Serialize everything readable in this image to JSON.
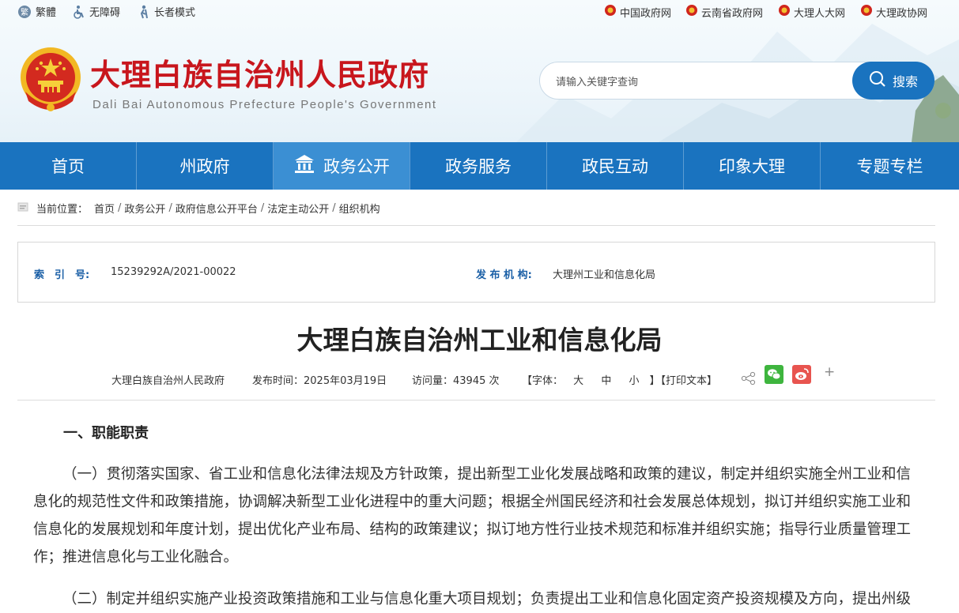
{
  "topbar": {
    "tools": [
      "繁體",
      "无障碍",
      "长者模式"
    ],
    "links": [
      "中国政府网",
      "云南省政府网",
      "大理人大网",
      "大理政协网"
    ]
  },
  "site": {
    "title": "大理白族自治州人民政府",
    "subtitle": "Dali Bai Autonomous Prefecture People's Government"
  },
  "search": {
    "placeholder": "请输入关键字查询",
    "button": "搜索"
  },
  "nav": [
    "首页",
    "州政府",
    "政务公开",
    "政务服务",
    "政民互动",
    "印象大理",
    "专题专栏"
  ],
  "breadcrumb": {
    "label": "当前位置：",
    "items": [
      "首页",
      "政务公开",
      "政府信息公开平台",
      "法定主动公开",
      "组织机构"
    ]
  },
  "info": {
    "index_label": "索　引　号:",
    "index_value": "15239292A/2021-00022",
    "org_label": "发 布 机 构:",
    "org_value": "大理州工业和信息化局"
  },
  "doc": {
    "title": "大理白族自治州工业和信息化局",
    "source": "大理白族自治州人民政府",
    "date": "发布时间：2025年03月19日",
    "visits": "访问量：43945 次",
    "font_label": "【字体：",
    "font_sizes": [
      "大",
      "中",
      "小"
    ],
    "font_close": "】",
    "print": "【打印文本】"
  },
  "content": {
    "section1": "一、职能职责",
    "p1": "（一）贯彻落实国家、省工业和信息化法律法规及方针政策，提出新型工业化发展战略和政策的建议，制定并组织实施全州工业和信息化的规范性文件和政策措施，协调解决新型工业化进程中的重大问题；根据全州国民经济和社会发展总体规划，拟订并组织实施工业和信息化的发展规划和年度计划，提出优化产业布局、结构的政策建议；拟订地方性行业技术规范和标准并组织实施；指导行业质量管理工作；推进信息化与工业化融合。",
    "p2": "（二）制定并组织实施产业投资政策措施和工业与信息化重大项目规划；负责提出工业和信息化固定资产投资规模及方向，提出州级"
  },
  "colors": {
    "brand_red": "#c8161d",
    "nav_blue": "#1a73bf",
    "nav_active": "#3b8fd3"
  }
}
